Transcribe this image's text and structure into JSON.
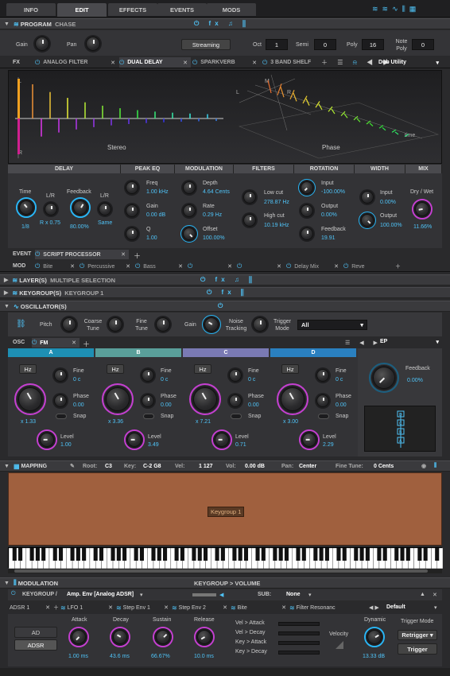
{
  "tabs": [
    "INFO",
    "EDIT",
    "EFFECTS",
    "EVENTS",
    "MODS"
  ],
  "program": {
    "title": "PROGRAM",
    "name": "CHASE",
    "gain": "Gain",
    "pan": "Pan",
    "streaming": "Streaming",
    "oct_label": "Oct",
    "oct": "1",
    "semi_label": "Semi",
    "semi": "0",
    "poly_label": "Poly",
    "poly": "16",
    "notepoly_label": "Note Poly",
    "notepoly": "0"
  },
  "fx": {
    "label": "FX",
    "slots": [
      "ANALOG FILTER",
      "DUAL DELAY",
      "SPARKVERB",
      "3 BAND SHELF"
    ],
    "preset": "Dub Utility"
  },
  "viz": {
    "l": "L",
    "r": "R",
    "m": "M",
    "l2": "L",
    "r2": "R",
    "stereo": "Stereo",
    "phase": "Phase",
    "time": "time"
  },
  "delay": {
    "sections": [
      "DELAY",
      "PEAK EQ",
      "MODULATION",
      "FILTERS",
      "ROTATION",
      "WIDTH",
      "MIX"
    ],
    "time": "Time",
    "time_v": "1/8",
    "lr": "L/R",
    "lr_v": "R x 0.75",
    "feedback": "Feedback",
    "feedback_v": "80.00%",
    "lr2": "L/R",
    "same": "Same",
    "freq": "Freq",
    "freq_v": "1.00 kHz",
    "gain": "Gain",
    "gain_v": "0.00 dB",
    "q": "Q",
    "q_v": "1.00",
    "depth": "Depth",
    "depth_v": "4.64 Cents",
    "rate": "Rate",
    "rate_v": "0.29 Hz",
    "offset": "Offset",
    "offset_v": "100.00%",
    "lowcut": "Low cut",
    "lowcut_v": "278.87 Hz",
    "highcut": "High cut",
    "highcut_v": "10.19 kHz",
    "input": "Input",
    "input_v": "-100.00%",
    "output": "Output",
    "output_v": "0.00%",
    "rfeedback": "Feedback",
    "rfeedback_v": "19.91",
    "winput": "Input",
    "winput_v": "0.00%",
    "woutput": "Output",
    "woutput_v": "100.00%",
    "drywet": "Dry / Wet",
    "drywet_v": "11.66%"
  },
  "event": {
    "label": "EVENT",
    "slot": "SCRIPT PROCESSOR"
  },
  "mod": {
    "label": "MOD",
    "slots": [
      "Bite",
      "Percussive",
      "Bass",
      "",
      "",
      "Delay Mix",
      "Reve"
    ]
  },
  "layers": {
    "title": "LAYER(S)",
    "value": "MULTIPLE SELECTION"
  },
  "keygroups": {
    "title": "KEYGROUP(S)",
    "value": "KEYGROUP 1"
  },
  "osc": {
    "title": "OSCILLATOR(S)",
    "pitch": "Pitch",
    "coarse": "Coarse Tune",
    "fine": "Fine Tune",
    "gain": "Gain",
    "noise": "Noise Tracking",
    "trigger": "Trigger Mode",
    "trigger_v": "All"
  },
  "oscfx": {
    "label": "OSC",
    "slot": "FM",
    "preset": "EP"
  },
  "ops": [
    {
      "name": "A",
      "color": "#1e8fb4",
      "ratio": "x 1.33",
      "fine_v": "0 c",
      "phase_v": "0.00",
      "level_v": "1.00"
    },
    {
      "name": "B",
      "color": "#5a9f9a",
      "ratio": "x 3.36",
      "fine_v": "0 c",
      "phase_v": "0.00",
      "level_v": "3.49"
    },
    {
      "name": "C",
      "color": "#7a7ab4",
      "ratio": "x 7.21",
      "fine_v": "0 c",
      "phase_v": "0.00",
      "level_v": "0.71"
    },
    {
      "name": "D",
      "color": "#2a80c0",
      "ratio": "x 3.00",
      "fine_v": "0 c",
      "phase_v": "0.00",
      "level_v": "2.29"
    }
  ],
  "oplabels": {
    "hz": "Hz",
    "fine": "Fine",
    "phase": "Phase",
    "snap": "Snap",
    "level": "Level"
  },
  "fmfeedback": {
    "label": "Feedback",
    "value": "0.00%"
  },
  "mapping": {
    "title": "MAPPING",
    "root_l": "Root:",
    "root": "C3",
    "key_l": "Key:",
    "key": "C-2 G8",
    "vel_l": "Vel:",
    "vel": "1 127",
    "vol_l": "Vol:",
    "vol": "0.00 dB",
    "pan_l": "Pan:",
    "pan": "Center",
    "fine_l": "Fine Tune:",
    "fine": "0 Cents",
    "kg": "Keygroup 1"
  },
  "modulation": {
    "title": "MODULATION",
    "path": "KEYGROUP > VOLUME",
    "target": "KEYGROUP /",
    "env": "Amp. Env [Analog ADSR]",
    "sub": "SUB:",
    "sub_v": "None",
    "slots": [
      "ADSR 1",
      "LFO 1",
      "Step Env 1",
      "Step Env 2",
      "Bite",
      "Filter Resonanc"
    ],
    "preset": "Default",
    "ad": "AD",
    "adsr": "ADSR",
    "attack": "Attack",
    "attack_v": "1.00 ms",
    "decay": "Decay",
    "decay_v": "43.6 ms",
    "sustain": "Sustain",
    "sustain_v": "66.67%",
    "release": "Release",
    "release_v": "10.0 ms",
    "vel_attack": "Vel > Attack",
    "vel_decay": "Vel > Decay",
    "key_attack": "Key > Attack",
    "key_decay": "Key > Decay",
    "velocity": "Velocity",
    "dynamic": "Dynamic",
    "dynamic_v": "13.33 dB",
    "trigmode": "Trigger Mode",
    "retrigger": "Retrigger",
    "trigger": "Trigger"
  },
  "colors": {
    "accent": "#4fc3f7",
    "purple": "#c53fd1",
    "mapping_bg": "#a0603e"
  }
}
